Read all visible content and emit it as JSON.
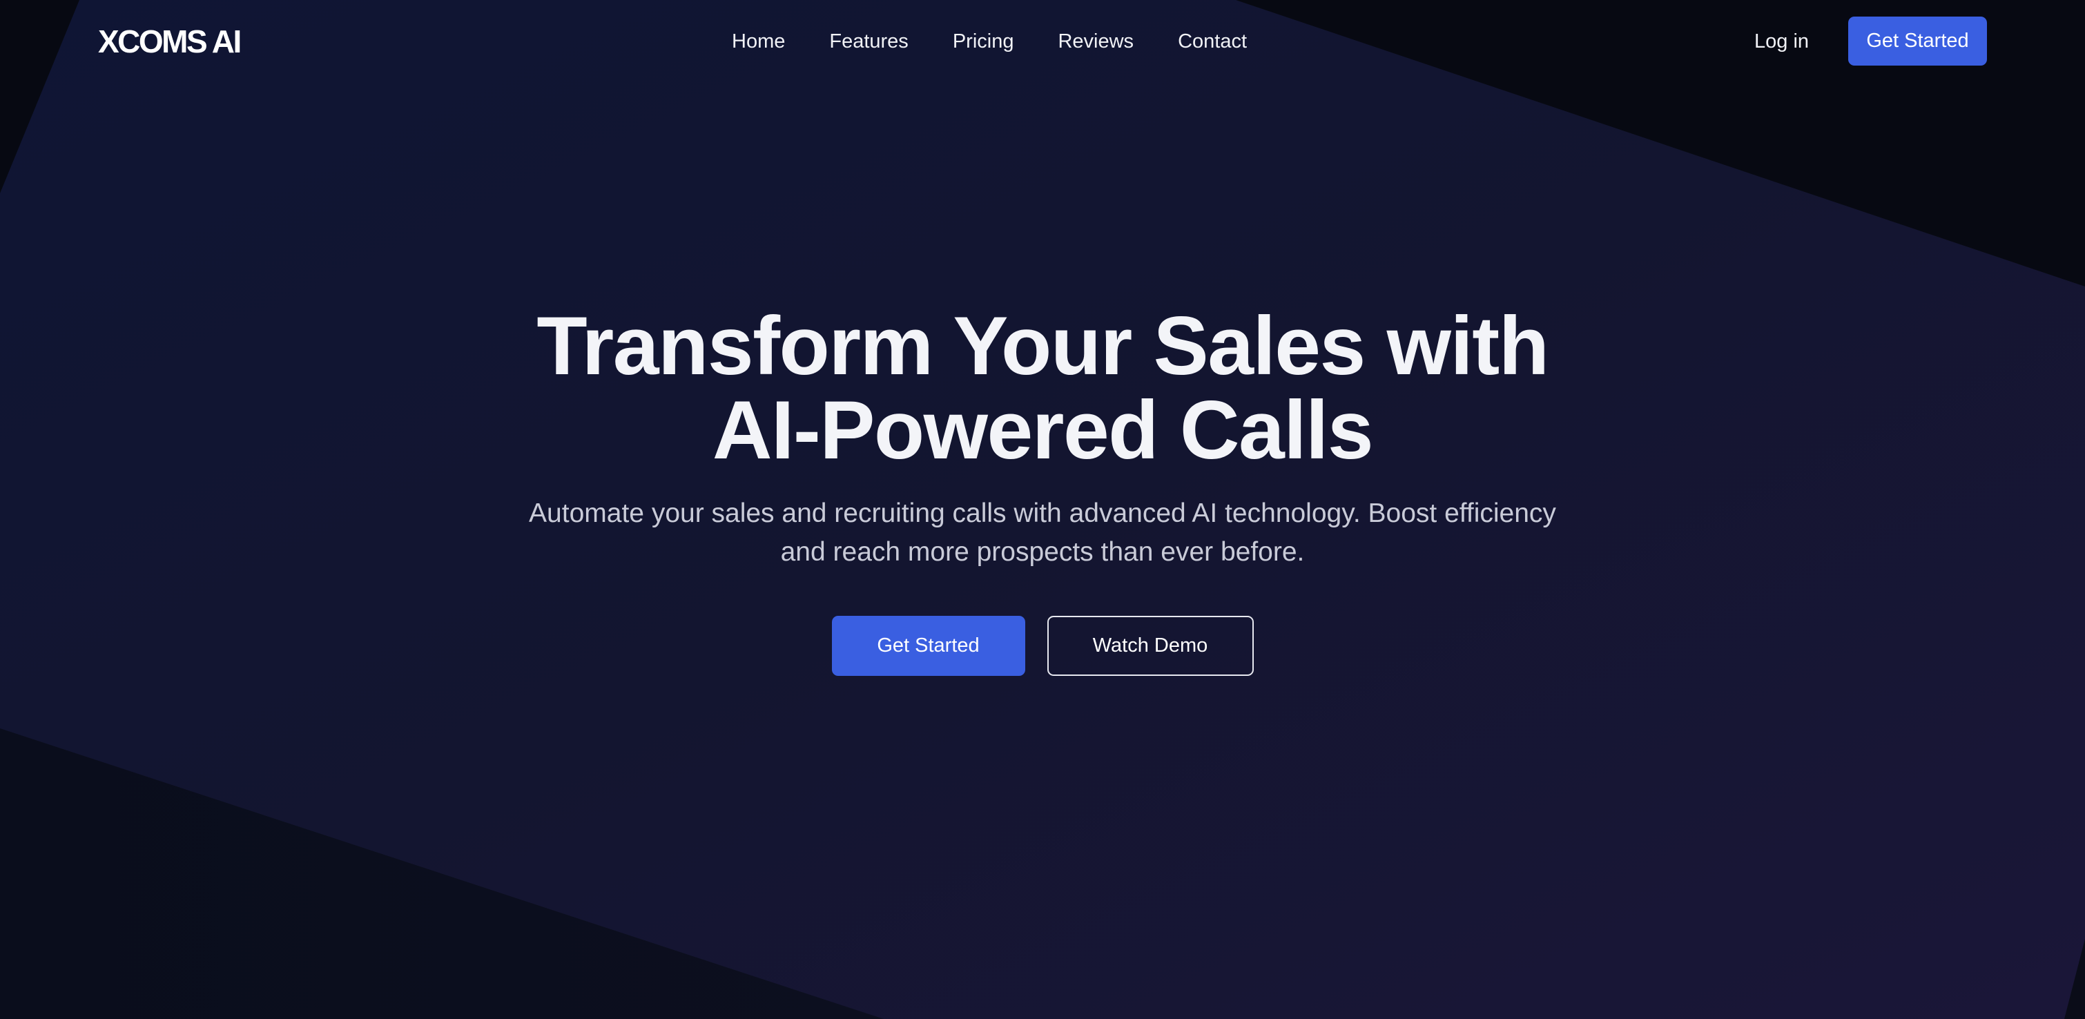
{
  "nav": {
    "logo": "XCOMS AI",
    "links": [
      "Home",
      "Features",
      "Pricing",
      "Reviews",
      "Contact"
    ],
    "login": "Log in",
    "cta": "Get Started"
  },
  "hero": {
    "title_line1": "Transform Your Sales with",
    "title_line2": "AI-Powered Calls",
    "subtitle_line1": "Automate your sales and recruiting calls with advanced AI technology. Boost efficiency",
    "subtitle_line2": "and reach more prospects than ever before.",
    "primary_cta": "Get Started",
    "secondary_cta": "Watch Demo"
  },
  "colors": {
    "accent": "#3a5fe1",
    "background_dark": "#080a14",
    "background_panel": "#12132b",
    "text_primary": "#f3f4f8",
    "text_secondary": "#c9cbd8"
  }
}
